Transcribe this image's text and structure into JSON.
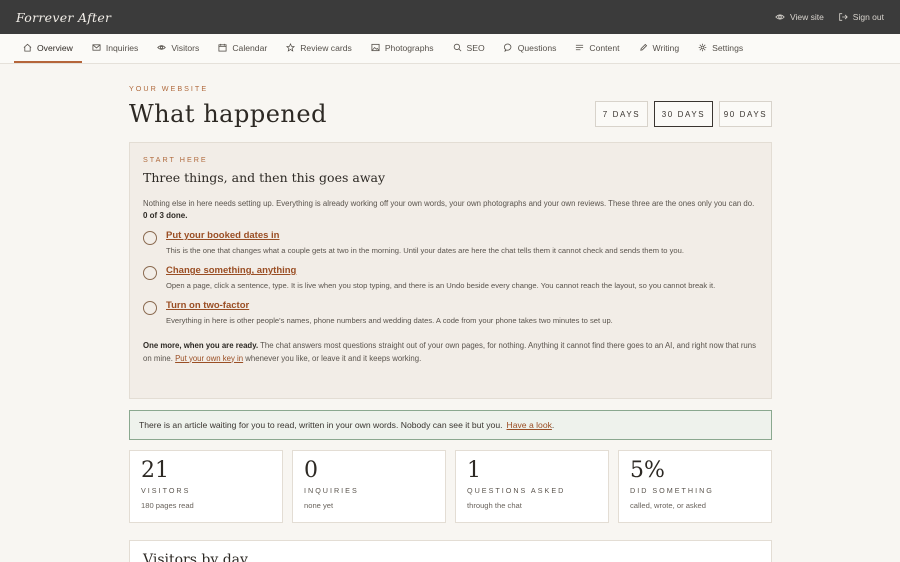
{
  "brand": "Forrever After",
  "topbar": {
    "view_site": "View site",
    "sign_out": "Sign out"
  },
  "nav": [
    {
      "label": "Overview",
      "icon": "home-icon"
    },
    {
      "label": "Inquiries",
      "icon": "mail-icon"
    },
    {
      "label": "Visitors",
      "icon": "eye-icon"
    },
    {
      "label": "Calendar",
      "icon": "calendar-icon"
    },
    {
      "label": "Review cards",
      "icon": "star-icon"
    },
    {
      "label": "Photographs",
      "icon": "image-icon"
    },
    {
      "label": "SEO",
      "icon": "search-icon"
    },
    {
      "label": "Questions",
      "icon": "chat-bubble-icon"
    },
    {
      "label": "Content",
      "icon": "lines-icon"
    },
    {
      "label": "Writing",
      "icon": "pencil-icon"
    },
    {
      "label": "Settings",
      "icon": "gear-icon"
    }
  ],
  "header": {
    "eyebrow": "YOUR WEBSITE",
    "title": "What happened",
    "ranges": [
      "7 DAYS",
      "30 DAYS",
      "90 DAYS"
    ],
    "selected_range": "30 DAYS"
  },
  "start": {
    "eyebrow": "START HERE",
    "title": "Three things, and then this goes away",
    "intro": "Nothing else in here needs setting up. Everything is already working off your own words, your own photographs and your own reviews. These three are the ones only you can do.",
    "progress": "0 of 3 done.",
    "tasks": [
      {
        "title": "Put your booked dates in",
        "desc": "This is the one that changes what a couple gets at two in the morning. Until your dates are here the chat tells them it cannot check and sends them to you."
      },
      {
        "title": "Change something, anything",
        "desc": "Open a page, click a sentence, type. It is live when you stop typing, and there is an Undo beside every change. You cannot reach the layout, so you cannot break it."
      },
      {
        "title": "Turn on two-factor",
        "desc": "Everything in here is other people's names, phone numbers and wedding dates. A code from your phone takes two minutes to set up."
      }
    ],
    "one_more_bold": "One more, when you are ready.",
    "one_more_text": "The chat answers most questions straight out of your own pages, for nothing. Anything it cannot find there goes to an AI, and right now that runs on mine.",
    "one_more_link": "Put your own key in",
    "one_more_tail": "whenever you like, or leave it and it keeps working."
  },
  "notice": {
    "text": "There is an article waiting for you to read, written in your own words. Nobody can see it but you.",
    "link": "Have a look",
    "tail": "."
  },
  "stats": [
    {
      "value": "21",
      "label": "VISITORS",
      "sub": "180 pages read"
    },
    {
      "value": "0",
      "label": "INQUIRIES",
      "sub": "none yet"
    },
    {
      "value": "1",
      "label": "QUESTIONS ASKED",
      "sub": "through the chat"
    },
    {
      "value": "5%",
      "label": "DID SOMETHING",
      "sub": "called, wrote, or asked"
    }
  ],
  "visitors_by_day": {
    "title": "Visitors by day"
  }
}
